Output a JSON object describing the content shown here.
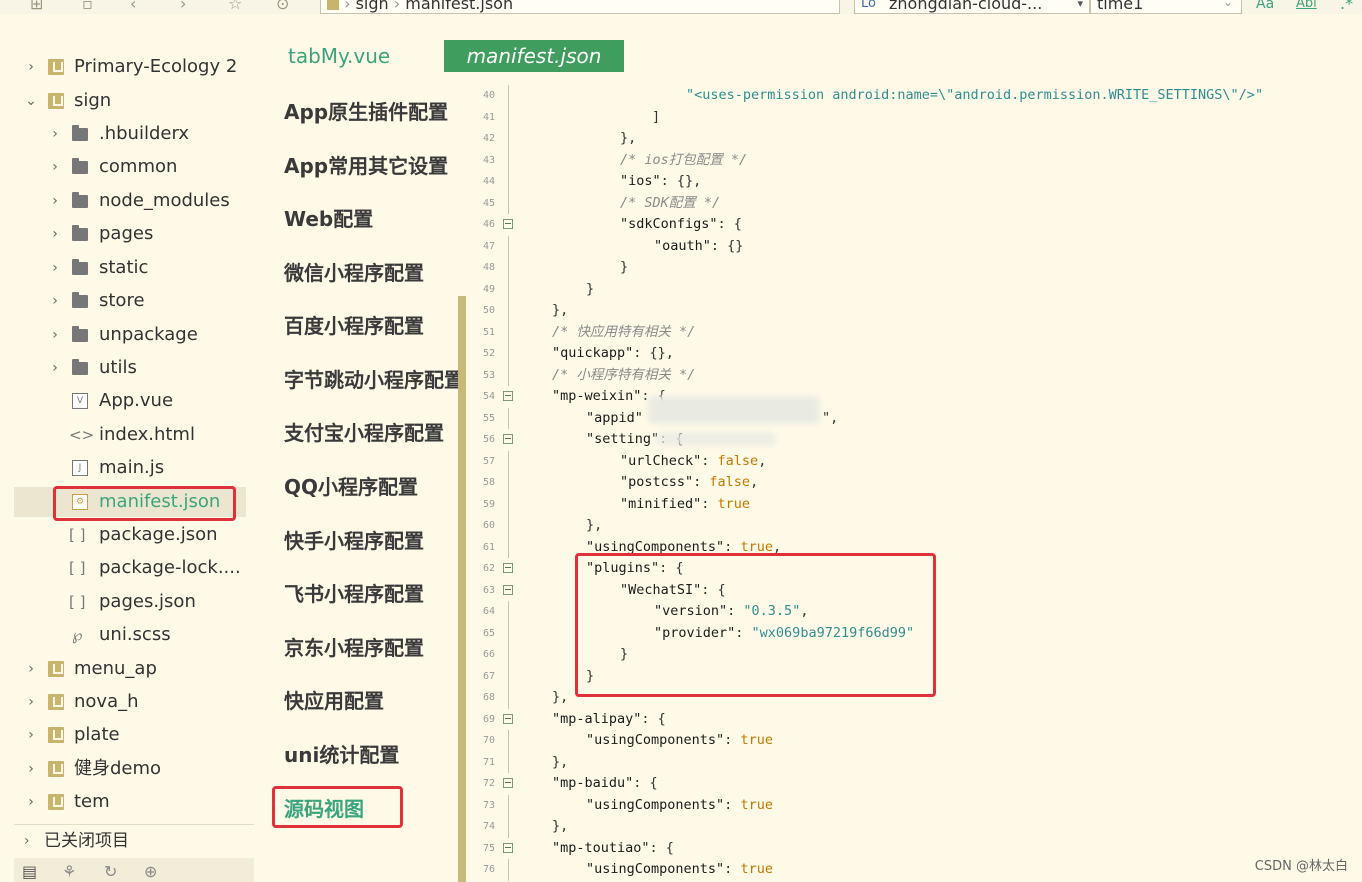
{
  "toolbar": {
    "breadcrumb_project": "sign",
    "breadcrumb_file": "manifest.json",
    "search_value": "zhongdian-cloud-...",
    "replace_value": "time1"
  },
  "tree": {
    "items": [
      {
        "label": "Primary-Ecology 2"
      },
      {
        "label": "sign"
      },
      {
        "label": ".hbuilderx"
      },
      {
        "label": "common"
      },
      {
        "label": "node_modules"
      },
      {
        "label": "pages"
      },
      {
        "label": "static"
      },
      {
        "label": "store"
      },
      {
        "label": "unpackage"
      },
      {
        "label": "utils"
      },
      {
        "label": "App.vue"
      },
      {
        "label": "index.html"
      },
      {
        "label": "main.js"
      },
      {
        "label": "manifest.json"
      },
      {
        "label": "package.json"
      },
      {
        "label": "package-lock...."
      },
      {
        "label": "pages.json"
      },
      {
        "label": "uni.scss"
      },
      {
        "label": "menu_ap"
      },
      {
        "label": "nova_h"
      },
      {
        "label": "plate"
      },
      {
        "label": "健身demo"
      },
      {
        "label": "tem"
      }
    ],
    "closed_projects": "已关闭项目"
  },
  "tabs": {
    "tab1": "tabMy.vue",
    "tab2": "manifest.json"
  },
  "categories": [
    "App原生插件配置",
    "App常用其它设置",
    "Web配置",
    "微信小程序配置",
    "百度小程序配置",
    "字节跳动小程序配置",
    "支付宝小程序配置",
    "QQ小程序配置",
    "快手小程序配置",
    "飞书小程序配置",
    "京东小程序配置",
    "快应用配置",
    "uni统计配置",
    "源码视图"
  ],
  "code": {
    "l40": {
      "num": "40",
      "text": "\"<uses-permission android:name=\\\"android.permission.WRITE_SETTINGS\\\"/>\""
    },
    "l41": {
      "num": "41",
      "text": "]"
    },
    "l42": {
      "num": "42",
      "text": "},"
    },
    "l43": {
      "num": "43",
      "text": "/* ios打包配置 */"
    },
    "l44": {
      "num": "44",
      "key": "\"ios\"",
      "rest": ": {},"
    },
    "l45": {
      "num": "45",
      "text": "/* SDK配置 */"
    },
    "l46": {
      "num": "46",
      "key": "\"sdkConfigs\"",
      "rest": ": {"
    },
    "l47": {
      "num": "47",
      "key": "\"oauth\"",
      "rest": ": {}"
    },
    "l48": {
      "num": "48",
      "text": "}"
    },
    "l49": {
      "num": "49",
      "text": "}"
    },
    "l50": {
      "num": "50",
      "text": "},"
    },
    "l51": {
      "num": "51",
      "text": "/* 快应用特有相关 */"
    },
    "l52": {
      "num": "52",
      "key": "\"quickapp\"",
      "rest": ": {},"
    },
    "l53": {
      "num": "53",
      "text": "/* 小程序特有相关 */"
    },
    "l54": {
      "num": "54",
      "key": "\"mp-weixin\"",
      "rest": ": {"
    },
    "l55": {
      "num": "55",
      "key": "\"appid\"",
      "rest": "\","
    },
    "l56": {
      "num": "56",
      "key": "\"setting\"",
      "rest": ": {"
    },
    "l57": {
      "num": "57",
      "key": "\"urlCheck\"",
      "val": "false",
      "rest": ","
    },
    "l58": {
      "num": "58",
      "key": "\"postcss\"",
      "val": "false",
      "rest": ","
    },
    "l59": {
      "num": "59",
      "key": "\"minified\"",
      "val": "true"
    },
    "l60": {
      "num": "60",
      "text": "},"
    },
    "l61": {
      "num": "61",
      "key": "\"usingComponents\"",
      "val": "true",
      "rest": ","
    },
    "l62": {
      "num": "62",
      "key": "\"plugins\"",
      "rest": ": {"
    },
    "l63": {
      "num": "63",
      "key": "\"WechatSI\"",
      "rest": ": {"
    },
    "l64": {
      "num": "64",
      "key": "\"version\"",
      "str": "\"0.3.5\"",
      "rest": ","
    },
    "l65": {
      "num": "65",
      "key": "\"provider\"",
      "str": "\"wx069ba97219f66d99\""
    },
    "l66": {
      "num": "66",
      "text": "}"
    },
    "l67": {
      "num": "67",
      "text": "}"
    },
    "l68": {
      "num": "68",
      "text": "},"
    },
    "l69": {
      "num": "69",
      "key": "\"mp-alipay\"",
      "rest": ": {"
    },
    "l70": {
      "num": "70",
      "key": "\"usingComponents\"",
      "val": "true"
    },
    "l71": {
      "num": "71",
      "text": "},"
    },
    "l72": {
      "num": "72",
      "key": "\"mp-baidu\"",
      "rest": ": {"
    },
    "l73": {
      "num": "73",
      "key": "\"usingComponents\"",
      "val": "true"
    },
    "l74": {
      "num": "74",
      "text": "},"
    },
    "l75": {
      "num": "75",
      "key": "\"mp-toutiao\"",
      "rest": ": {"
    },
    "l76": {
      "num": "76",
      "key": "\"usingComponents\"",
      "val": "true"
    }
  },
  "watermark": "CSDN @林太白"
}
